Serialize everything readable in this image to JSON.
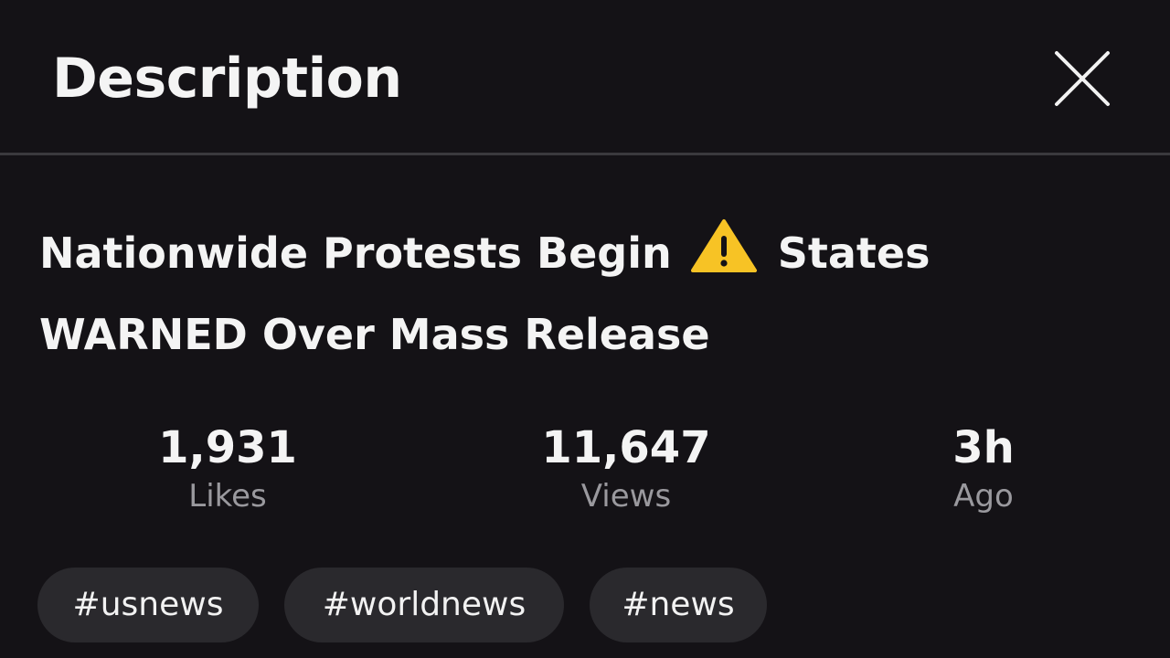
{
  "header": {
    "title": "Description",
    "close_icon": "close-icon"
  },
  "video": {
    "title_part1": "Nationwide Protests Begin",
    "title_icon": "warning-icon",
    "title_part2": "States WARNED Over Mass Release"
  },
  "stats": [
    {
      "value": "1,931",
      "label": "Likes"
    },
    {
      "value": "11,647",
      "label": "Views"
    },
    {
      "value": "3h",
      "label": "Ago"
    }
  ],
  "tags": [
    "#usnews",
    "#worldnews",
    "#news"
  ],
  "colors": {
    "background": "#141216",
    "divider": "#3a393d",
    "tag_background": "#2a292d",
    "muted_text": "#9a999e",
    "warning_yellow": "#f7c325"
  }
}
